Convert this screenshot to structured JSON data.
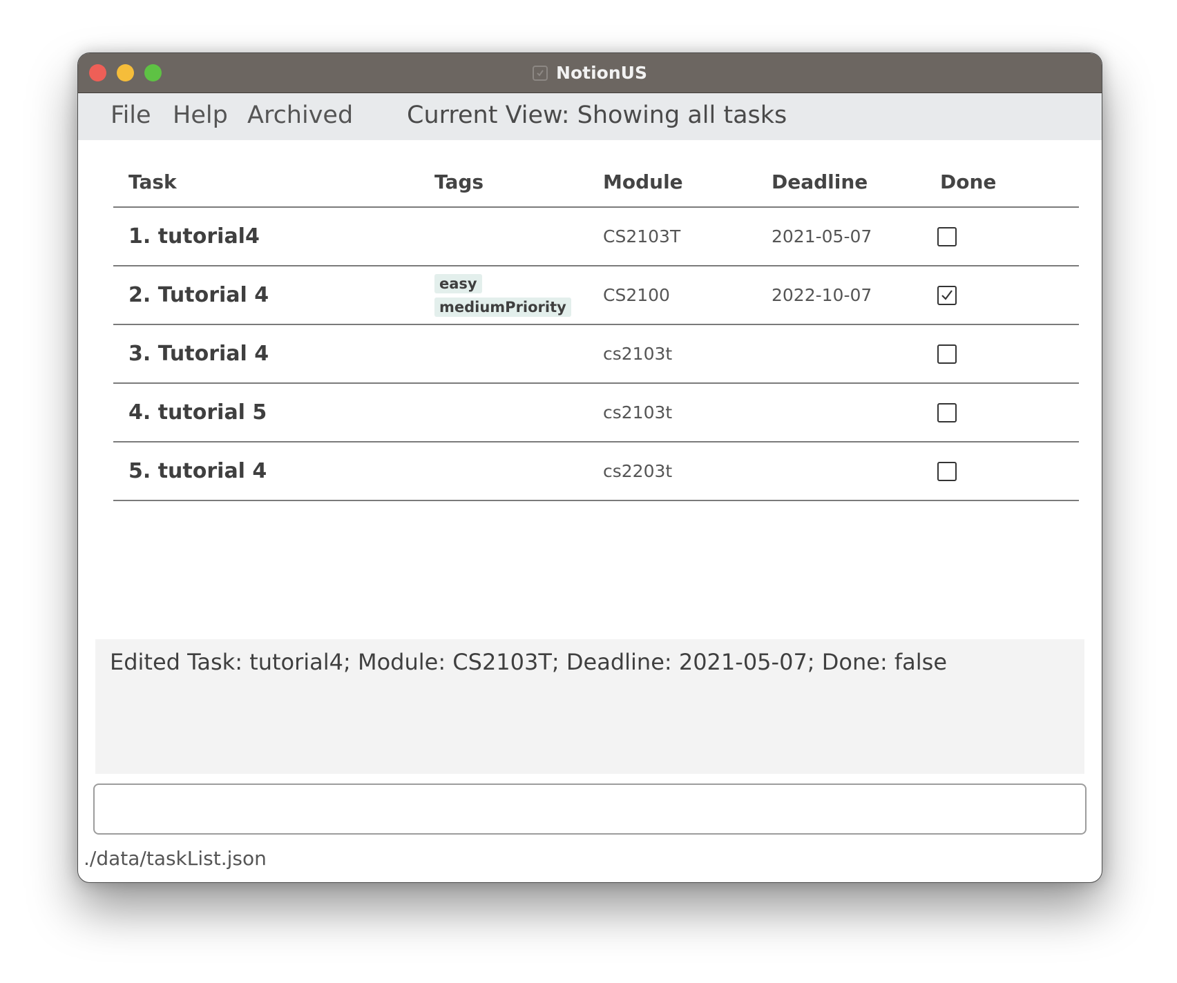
{
  "window": {
    "title": "NotionUS"
  },
  "menu": {
    "file": "File",
    "help": "Help",
    "archived": "Archived",
    "current_view": "Current View: Showing all tasks"
  },
  "table": {
    "headers": [
      "Task",
      "Tags",
      "Module",
      "Deadline",
      "Done"
    ],
    "rows": [
      {
        "name": "1. tutorial4",
        "tags": [],
        "module": "CS2103T",
        "deadline": "2021-05-07",
        "done": false
      },
      {
        "name": "2. Tutorial 4",
        "tags": [
          "easy",
          "mediumPriority"
        ],
        "module": "CS2100",
        "deadline": "2022-10-07",
        "done": true
      },
      {
        "name": "3. Tutorial 4",
        "tags": [],
        "module": "cs2103t",
        "deadline": "",
        "done": false
      },
      {
        "name": "4. tutorial 5",
        "tags": [],
        "module": "cs2103t",
        "deadline": "",
        "done": false
      },
      {
        "name": "5. tutorial 4",
        "tags": [],
        "module": "cs2203t",
        "deadline": "",
        "done": false
      }
    ]
  },
  "result": {
    "message": "Edited Task: tutorial4; Module: CS2103T; Deadline: 2021-05-07; Done: false"
  },
  "command": {
    "value": "",
    "placeholder": ""
  },
  "status": {
    "file_path": "./data/taskList.json"
  },
  "icons": {
    "close": "close-icon",
    "minimize": "minimize-icon",
    "zoom": "zoom-icon",
    "app": "app-icon",
    "check": "check-icon"
  },
  "colors": {
    "titlebar": "#6c6661",
    "menubar": "#e8eaec",
    "tag_bg": "#e3efec",
    "result_bg": "#f3f3f3"
  }
}
